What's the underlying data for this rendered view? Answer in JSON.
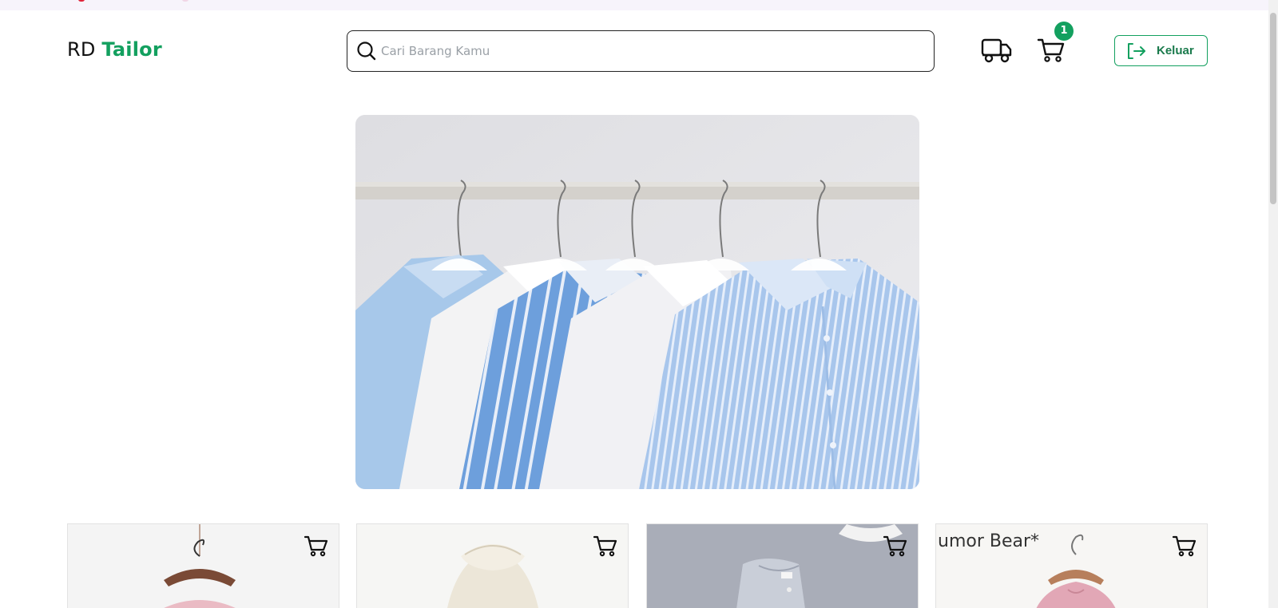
{
  "brand": {
    "prefix": "RD",
    "accent": "Tailor",
    "accent_color": "#13a05f"
  },
  "search": {
    "placeholder": "Cari Barang Kamu",
    "value": "",
    "icon": "search-icon"
  },
  "header_actions": {
    "orders_icon": "truck-icon",
    "cart_icon": "cart-icon",
    "cart_count": "1",
    "logout_label": "Keluar",
    "logout_icon": "logout-icon"
  },
  "hero": {
    "image": "shirts-on-hangers-banner"
  },
  "products": [
    {
      "image": "pink-dress-on-hanger",
      "cart_icon": "cart-icon"
    },
    {
      "image": "cream-ruffle-blouse",
      "cart_icon": "cart-icon"
    },
    {
      "image": "grey-knit-top",
      "cart_icon": "cart-icon"
    },
    {
      "image": "pink-dress-humor-bear",
      "cart_icon": "cart-icon",
      "logo_text": "umor Bear"
    }
  ],
  "colors": {
    "accent": "#13a05f",
    "badge": "#13a05f",
    "text": "#111111"
  }
}
